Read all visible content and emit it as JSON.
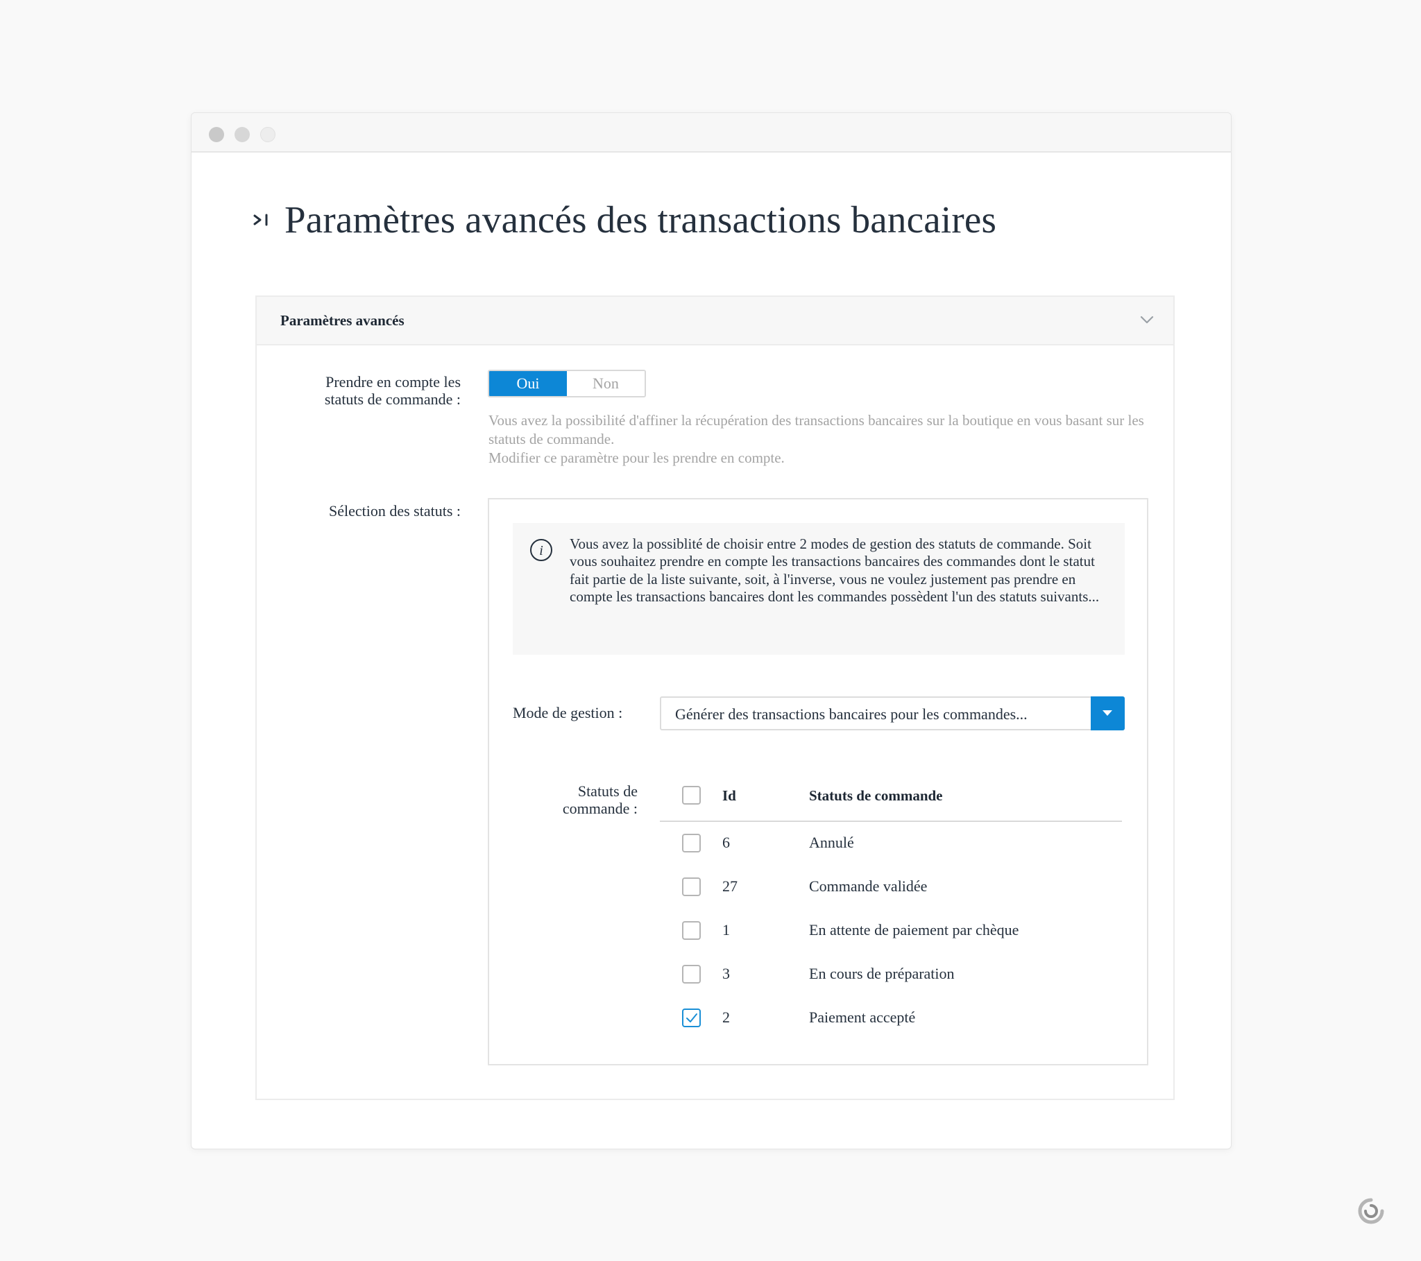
{
  "page": {
    "title": "Paramètres avancés des transactions bancaires"
  },
  "panel": {
    "title": "Paramètres avancés"
  },
  "order_status_toggle": {
    "label": "Prendre en compte les statuts de commande :",
    "options": [
      "Oui",
      "Non"
    ],
    "selected": "Oui",
    "help": "Vous avez la possibilité d'affiner la récupération des transactions bancaires sur la boutique en vous basant sur les statuts de commande.",
    "help2": "Modifier ce paramètre pour les prendre en compte."
  },
  "selection": {
    "label": "Sélection des statuts :",
    "info": "Vous avez la possiblité de choisir entre 2 modes de gestion des statuts de commande. Soit vous souhaitez prendre en compte les transactions bancaires des commandes dont le statut fait partie de la liste suivante, soit, à l'inverse, vous ne voulez justement pas prendre en compte les transactions bancaires dont les commandes possèdent l'un des statuts suivants...",
    "mode_label": "Mode de gestion :",
    "mode_value": "Générer des transactions bancaires pour les commandes...",
    "statuses_label": "Statuts de commande :",
    "table": {
      "headers": {
        "id": "Id",
        "status": "Statuts de commande"
      },
      "rows": [
        {
          "id": "6",
          "status": "Annulé",
          "checked": false
        },
        {
          "id": "27",
          "status": "Commande validée",
          "checked": false
        },
        {
          "id": "1",
          "status": "En attente de paiement par chèque",
          "checked": false
        },
        {
          "id": "3",
          "status": "En cours de préparation",
          "checked": false
        },
        {
          "id": "2",
          "status": "Paiement accepté",
          "checked": true
        }
      ]
    }
  },
  "colors": {
    "accent": "#0d87d6",
    "text": "#25303d",
    "muted": "#a4a4a4"
  },
  "icons": [
    "window-close-dot",
    "window-minimize-dot",
    "window-maximize-dot",
    "chevron-right-bar-icon",
    "chevron-down-icon",
    "info-icon",
    "caret-down-icon",
    "checkmark-icon",
    "brand-logo-icon"
  ]
}
